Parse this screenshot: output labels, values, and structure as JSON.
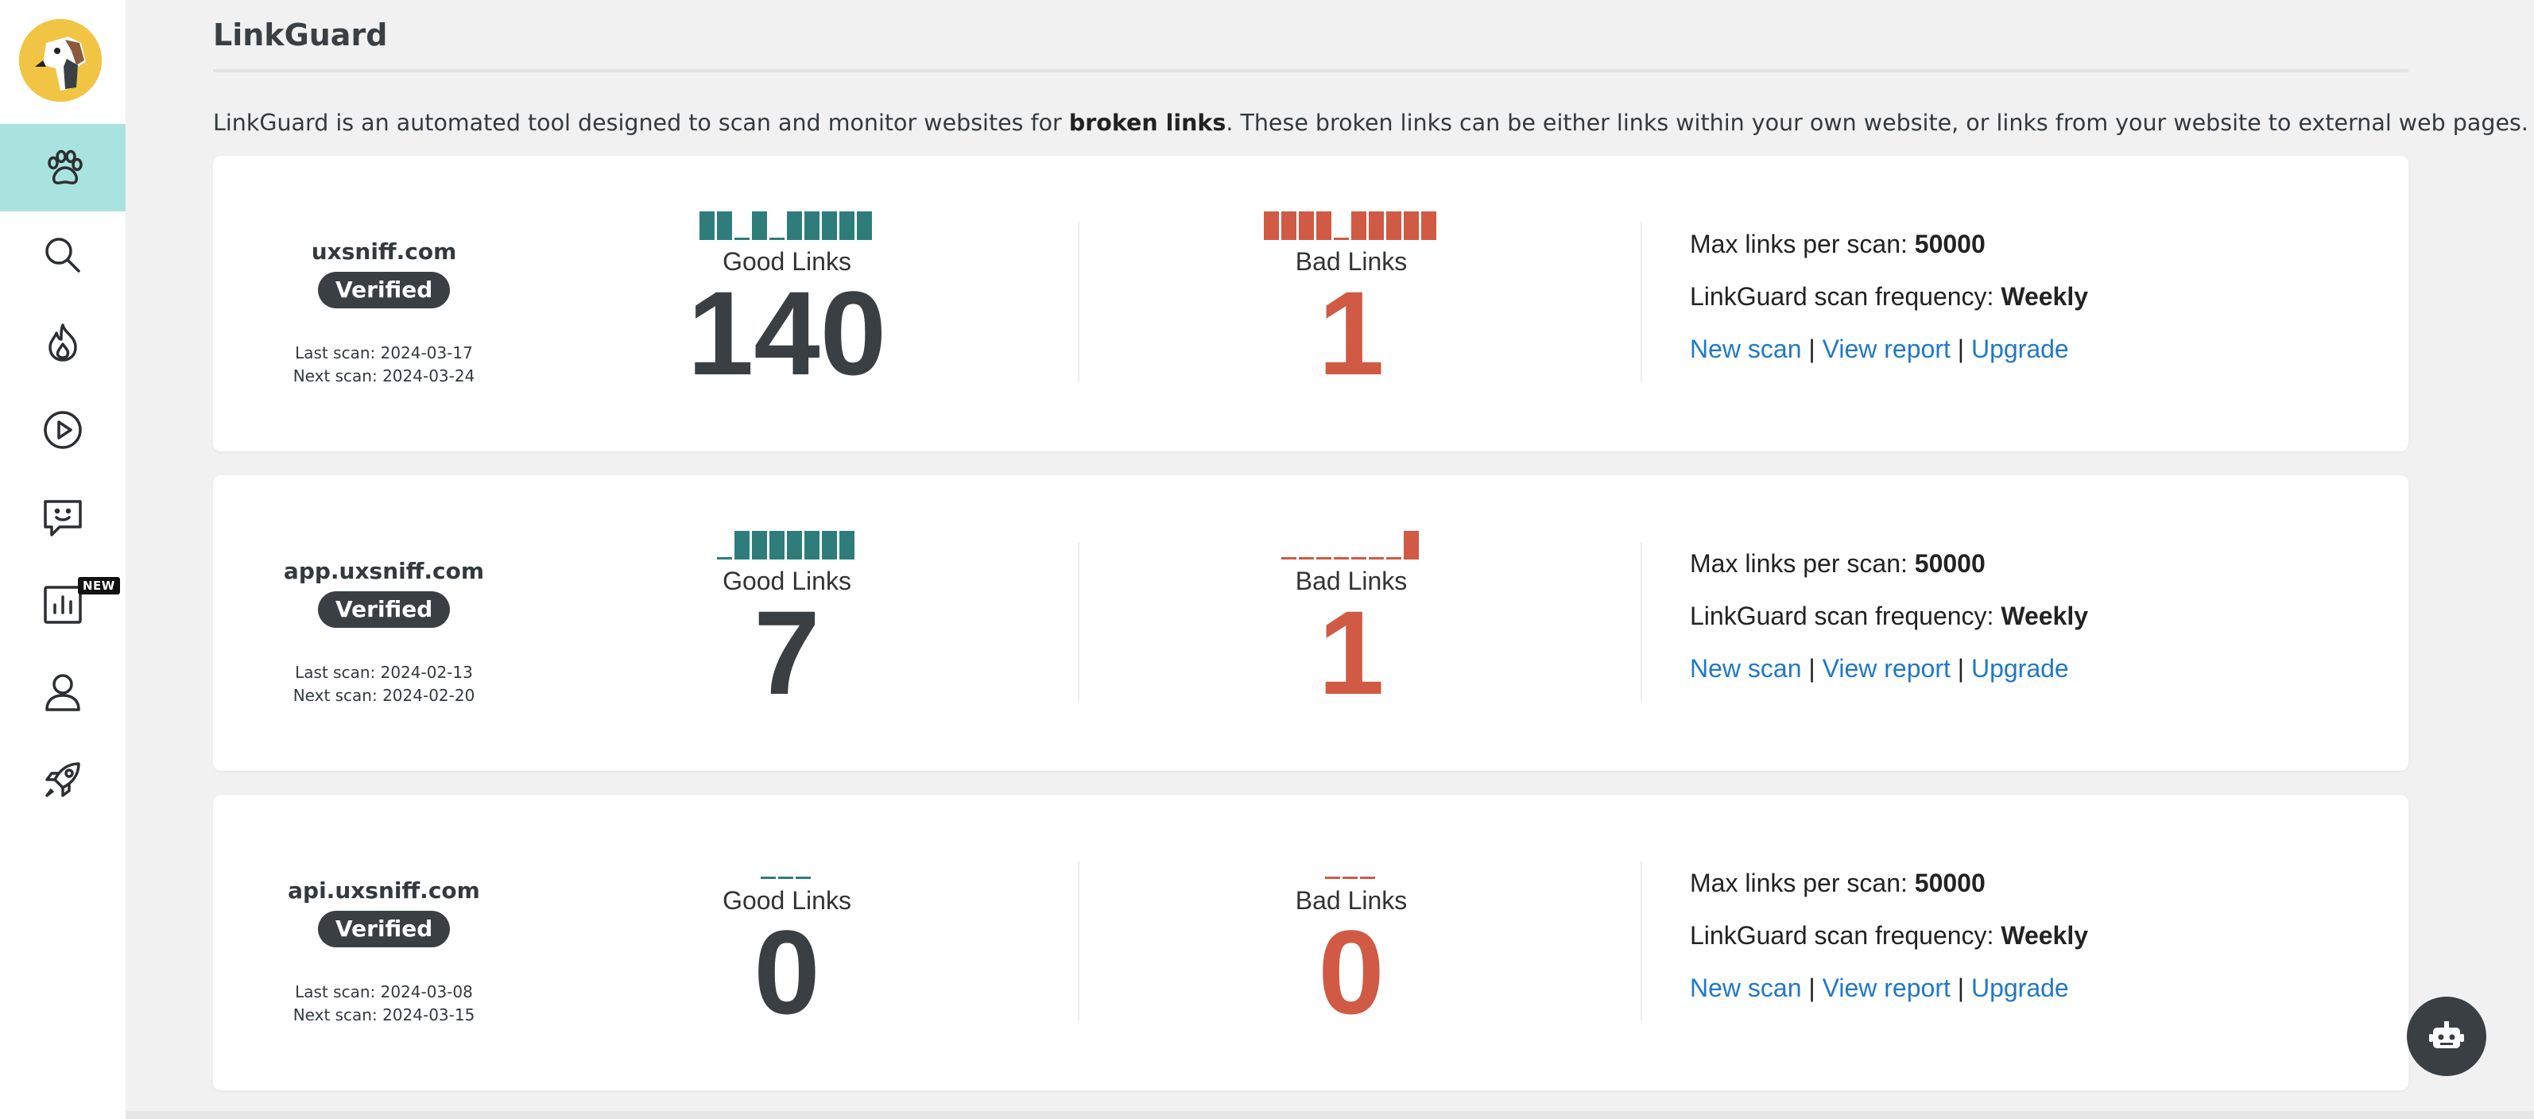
{
  "header": {
    "title": "LinkGuard"
  },
  "intro": {
    "before": "LinkGuard is an automated tool designed to scan and monitor websites for ",
    "bold": "broken links",
    "after": ". These broken links can be either links within your own website, or links from your website to external web pages."
  },
  "sidebar": {
    "items": [
      {
        "name": "paw-icon",
        "active": true
      },
      {
        "name": "search-icon"
      },
      {
        "name": "flame-icon"
      },
      {
        "name": "play-icon"
      },
      {
        "name": "chat-icon"
      },
      {
        "name": "chart-icon",
        "badge": "NEW"
      },
      {
        "name": "user-icon"
      },
      {
        "name": "rocket-icon"
      }
    ]
  },
  "colors": {
    "good": "#2e7d7a",
    "bad": "#d05a44",
    "accent": "#a9e3df",
    "link": "#1f78c8"
  },
  "sites": [
    {
      "domain": "uxsniff.com",
      "status": "Verified",
      "last_scan": "Last scan: 2024-03-17",
      "next_scan": "Next scan: 2024-03-24",
      "good_label": "Good Links",
      "good_count": "140",
      "good_bars": [
        1,
        1,
        0,
        1,
        0,
        1,
        1,
        1,
        1,
        1
      ],
      "bad_label": "Bad Links",
      "bad_count": "1",
      "bad_bars": [
        1,
        1,
        1,
        1,
        0,
        1,
        1,
        1,
        1,
        1
      ],
      "max_links_label": "Max links per scan:",
      "max_links_value": "50000",
      "freq_label": "LinkGuard scan frequency:",
      "freq_value": "Weekly",
      "new_scan": "New scan",
      "view_report": "View report",
      "upgrade": "Upgrade",
      "sep": "|"
    },
    {
      "domain": "app.uxsniff.com",
      "status": "Verified",
      "last_scan": "Last scan: 2024-02-13",
      "next_scan": "Next scan: 2024-02-20",
      "good_label": "Good Links",
      "good_count": "7",
      "good_bars": [
        0,
        1,
        1,
        1,
        1,
        1,
        1,
        1
      ],
      "bad_label": "Bad Links",
      "bad_count": "1",
      "bad_bars": [
        0,
        0,
        0,
        0,
        0,
        0,
        0,
        1
      ],
      "max_links_label": "Max links per scan:",
      "max_links_value": "50000",
      "freq_label": "LinkGuard scan frequency:",
      "freq_value": "Weekly",
      "new_scan": "New scan",
      "view_report": "View report",
      "upgrade": "Upgrade",
      "sep": "|"
    },
    {
      "domain": "api.uxsniff.com",
      "status": "Verified",
      "last_scan": "Last scan: 2024-03-08",
      "next_scan": "Next scan: 2024-03-15",
      "good_label": "Good Links",
      "good_count": "0",
      "good_bars": [
        0,
        0,
        0
      ],
      "bad_label": "Bad Links",
      "bad_count": "0",
      "bad_bars": [
        0,
        0,
        0
      ],
      "max_links_label": "Max links per scan:",
      "max_links_value": "50000",
      "freq_label": "LinkGuard scan frequency:",
      "freq_value": "Weekly",
      "new_scan": "New scan",
      "view_report": "View report",
      "upgrade": "Upgrade",
      "sep": "|"
    }
  ],
  "chat_button": {
    "icon": "robot-icon"
  }
}
